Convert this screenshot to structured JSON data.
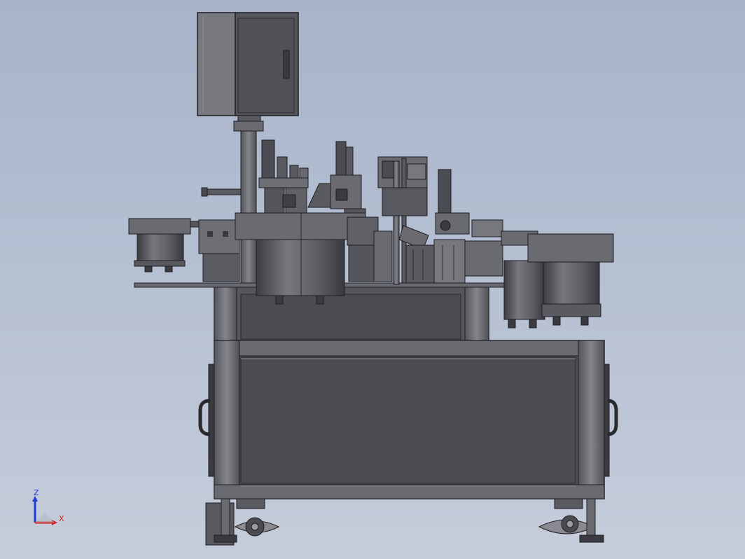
{
  "triad": {
    "z_label": "Z",
    "x_label": "X",
    "colors": {
      "z": "#1f3bd6",
      "x": "#d02020",
      "y": "#2a9d2a"
    }
  },
  "colors": {
    "background_top": "#a7b3c8",
    "background_bottom": "#c5cdda",
    "metal_dark": "#4b4b52",
    "metal_mid": "#6b6b72",
    "metal_light": "#8a8a92",
    "edge": "#1e1e22"
  }
}
